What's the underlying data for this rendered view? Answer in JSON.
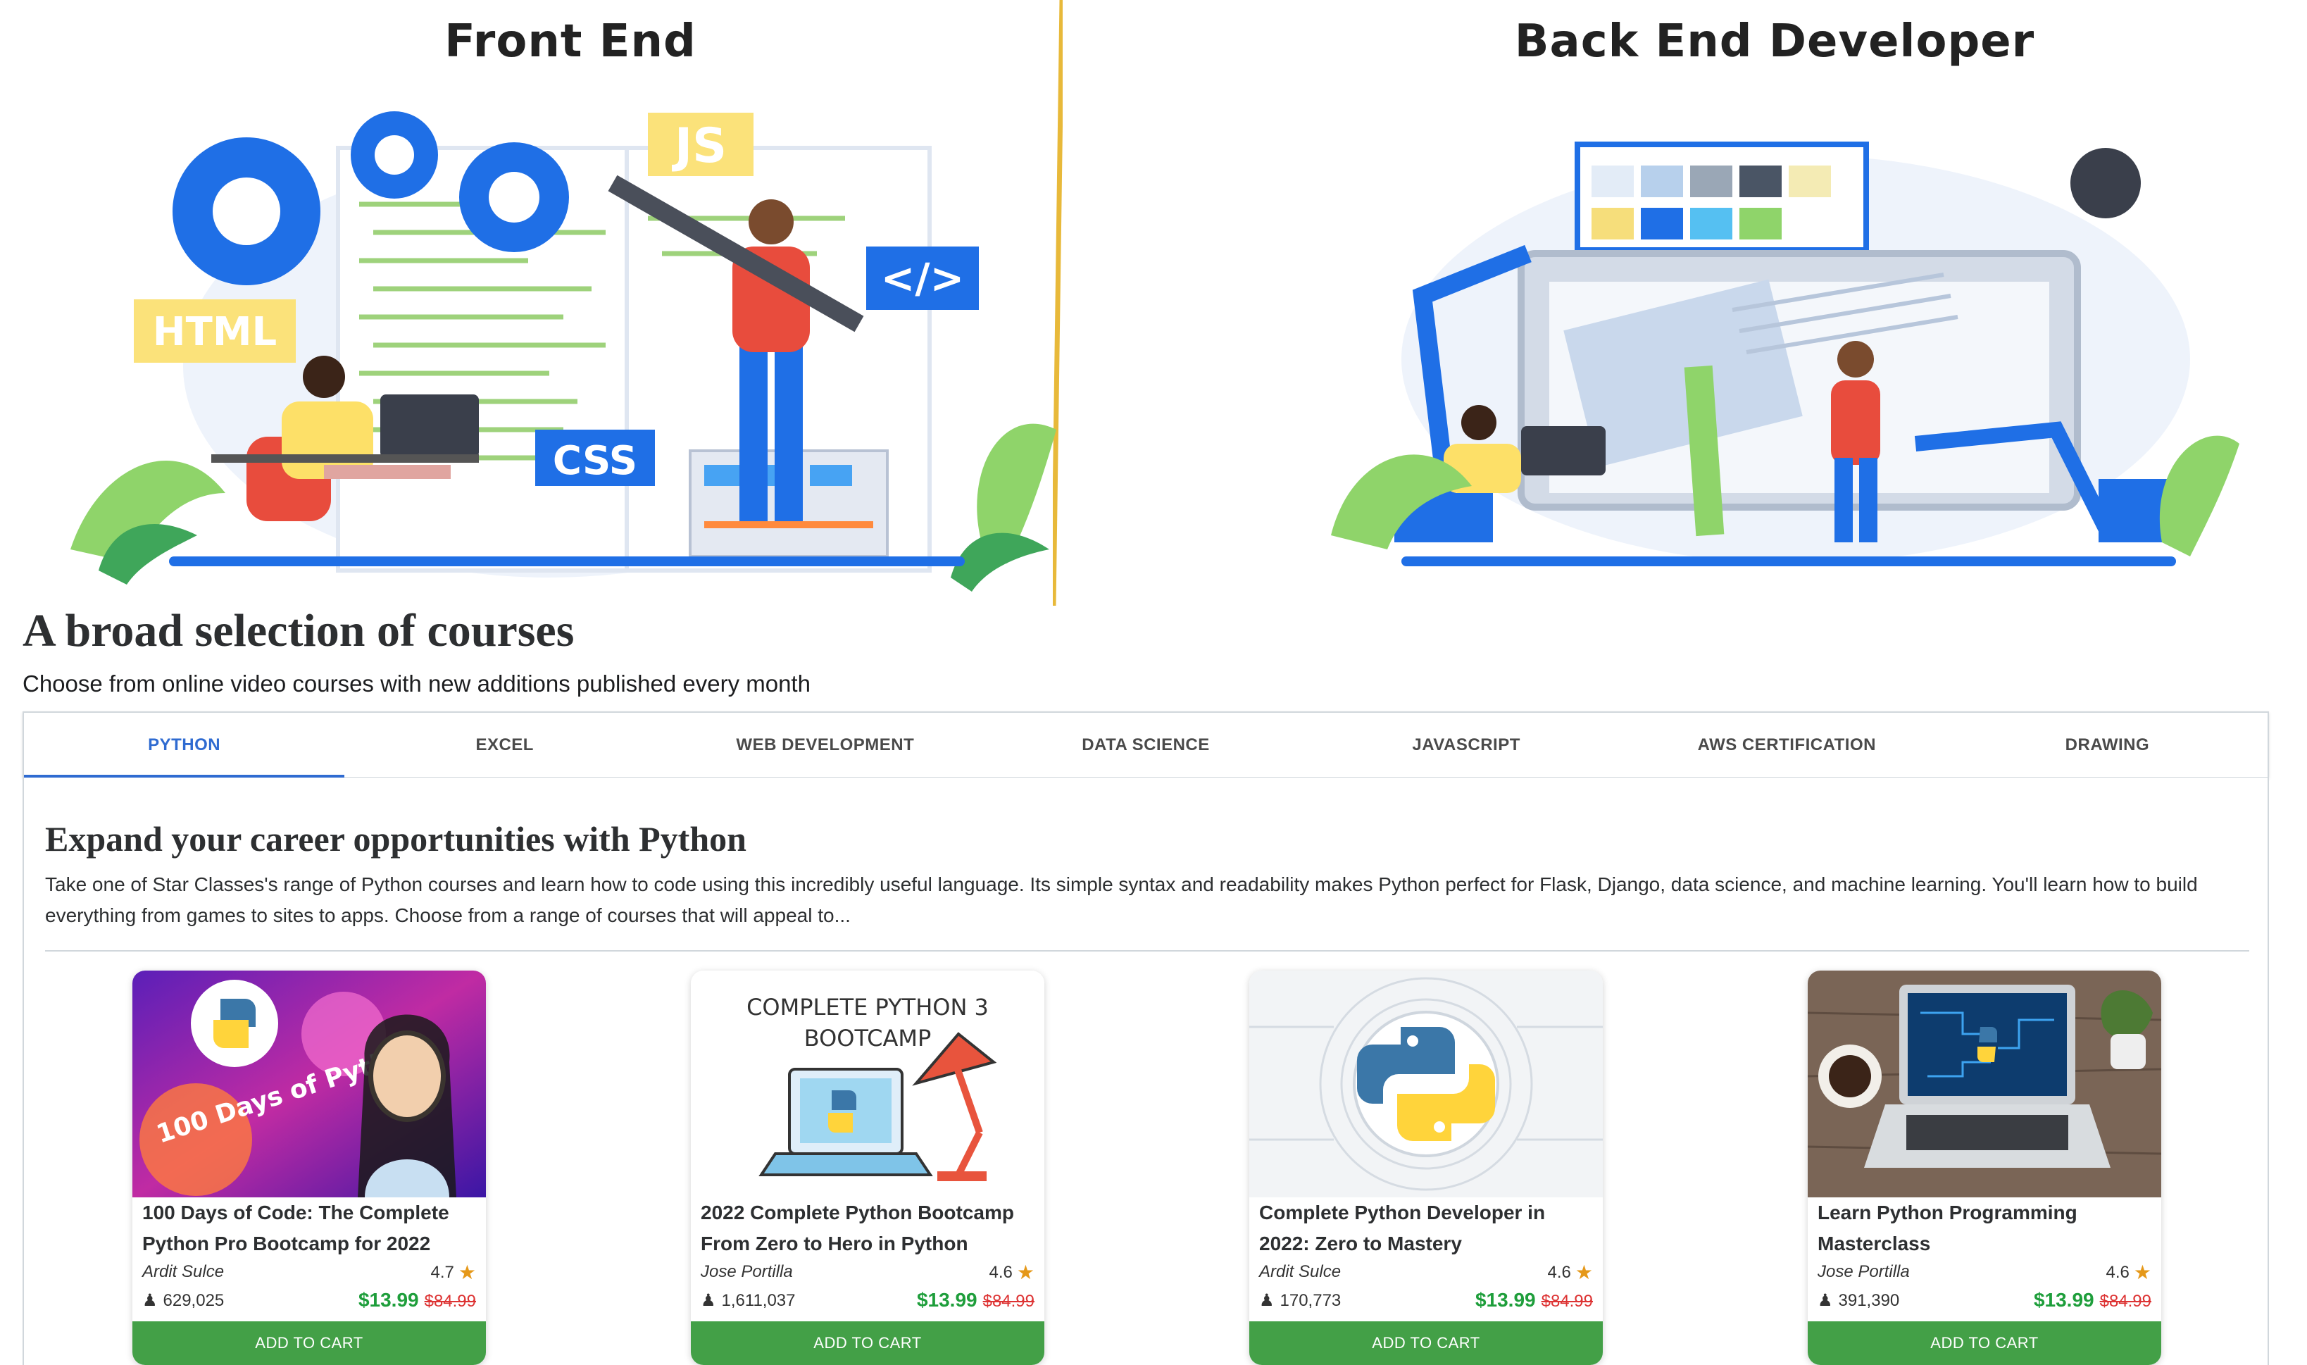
{
  "hero": {
    "left_title": "Front End",
    "right_title": "Back End Developer",
    "left_tags": {
      "html": "HTML",
      "css": "CSS",
      "js": "JS",
      "code": "</>"
    }
  },
  "section": {
    "title": "A broad selection of courses",
    "subtitle": "Choose from online video courses with new additions published every month"
  },
  "tabs": [
    {
      "label": "PYTHON",
      "active": true
    },
    {
      "label": "EXCEL",
      "active": false
    },
    {
      "label": "WEB DEVELOPMENT",
      "active": false
    },
    {
      "label": "DATA SCIENCE",
      "active": false
    },
    {
      "label": "JAVASCRIPT",
      "active": false
    },
    {
      "label": "AWS CERTIFICATION",
      "active": false
    },
    {
      "label": "DRAWING",
      "active": false
    }
  ],
  "panel": {
    "title": "Expand your career opportunities with Python",
    "description": "Take one of Star Classes's range of Python courses and learn how to code using this incredibly useful language. Its simple syntax and readability makes Python perfect for Flask, Django, data science, and machine learning. You'll learn how to build everything from games to sites to apps. Choose from a range of courses that will appeal to..."
  },
  "cards": [
    {
      "title": "100 Days of Code: The Complete Python Pro Bootcamp for 2022",
      "author": "Ardit Sulce",
      "rating": "4.7",
      "students": "629,025",
      "price": "$13.99",
      "old_price": "$84.99",
      "button": "ADD TO CART",
      "thumb_text": "100 Days of Python"
    },
    {
      "title": "2022 Complete Python Bootcamp From Zero to Hero in Python",
      "author": "Jose Portilla",
      "rating": "4.6",
      "students": "1,611,037",
      "price": "$13.99",
      "old_price": "$84.99",
      "button": "ADD TO CART",
      "thumb_text": "COMPLETE PYTHON 3 BOOTCAMP"
    },
    {
      "title": "Complete Python Developer in 2022: Zero to Mastery",
      "author": "Ardit Sulce",
      "rating": "4.6",
      "students": "170,773",
      "price": "$13.99",
      "old_price": "$84.99",
      "button": "ADD TO CART"
    },
    {
      "title": "Learn Python Programming Masterclass",
      "author": "Jose Portilla",
      "rating": "4.6",
      "students": "391,390",
      "price": "$13.99",
      "old_price": "$84.99",
      "button": "ADD TO CART"
    }
  ],
  "colors": {
    "accent_blue": "#2f6bd1",
    "price_green": "#1e9e3b",
    "cart_green": "#43a047",
    "strike_red": "#d33333",
    "star": "#e59819",
    "divider_gold": "#e8b93a"
  }
}
